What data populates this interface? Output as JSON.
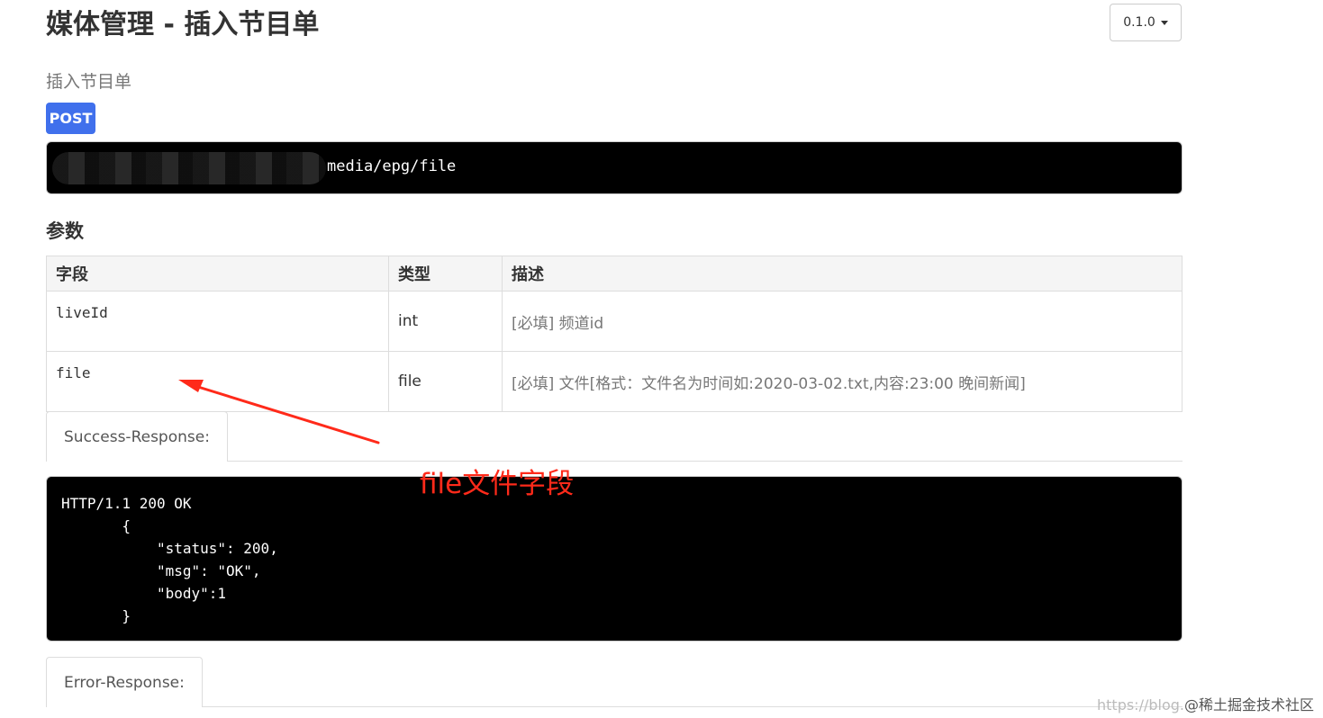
{
  "header": {
    "title": "媒体管理 - 插入节目单",
    "version_label": "0.1.0"
  },
  "endpoint": {
    "subtitle": "插入节目单",
    "method": "POST",
    "url_path": "media/epg/file"
  },
  "params": {
    "section_title": "参数",
    "columns": [
      "字段",
      "类型",
      "描述"
    ],
    "rows": [
      {
        "field": "liveId",
        "type": "int",
        "desc": "[必填] 频道id"
      },
      {
        "field": "file",
        "type": "file",
        "desc": "[必填] 文件[格式：文件名为时间如:2020-03-02.txt,内容:23:00 晚间新闻]"
      }
    ]
  },
  "responses": {
    "success_tab": "Success-Response:",
    "success_body": "HTTP/1.1 200 OK\n       {\n           \"status\": 200,\n           \"msg\": \"OK\",\n           \"body\":1\n       }",
    "error_tab": "Error-Response:"
  },
  "annotation": {
    "text": "file文件字段",
    "color": "#ff2a1a"
  },
  "watermark": {
    "prefix": "https://blog.",
    "suffix": "@稀土掘金技术社区"
  },
  "colors": {
    "method_badge": "#4070ec",
    "code_background": "#000000"
  }
}
